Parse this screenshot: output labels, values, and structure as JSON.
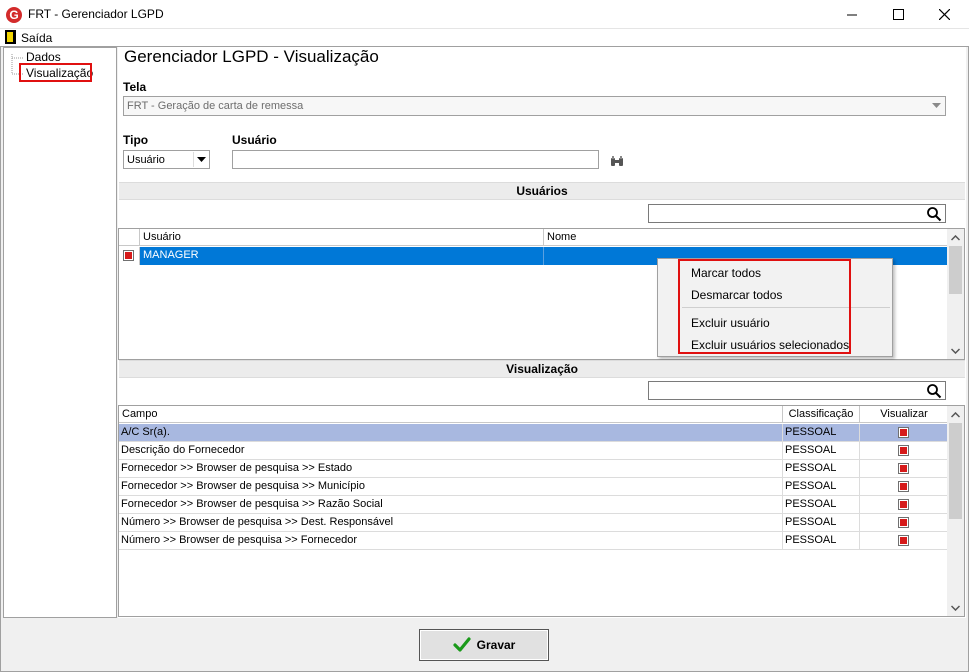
{
  "window": {
    "title": "FRT - Gerenciador LGPD",
    "app_icon_letter": "G"
  },
  "menu": {
    "exit_label": "Saída"
  },
  "tree": {
    "items": [
      "Dados",
      "Visualização"
    ]
  },
  "page": {
    "title": "Gerenciador LGPD - Visualização"
  },
  "form": {
    "tela_label": "Tela",
    "tela_value": "FRT - Geração de carta de remessa",
    "tipo_label": "Tipo",
    "tipo_value": "Usuário",
    "usuario_label": "Usuário",
    "usuario_value": ""
  },
  "users_section": {
    "title": "Usuários",
    "search_value": "",
    "columns": [
      "Usuário",
      "Nome"
    ],
    "rows": [
      {
        "checked": true,
        "usuario": "MANAGER",
        "nome": ""
      }
    ]
  },
  "context_menu": {
    "items": [
      "Marcar todos",
      "Desmarcar todos",
      "Excluir usuário",
      "Excluir usuários selecionados"
    ]
  },
  "view_section": {
    "title": "Visualização",
    "search_value": "",
    "columns": [
      "Campo",
      "Classificação",
      "Visualizar"
    ],
    "rows": [
      {
        "campo": "A/C Sr(a).",
        "classificacao": "PESSOAL",
        "visualizar": true
      },
      {
        "campo": "Descrição do Fornecedor",
        "classificacao": "PESSOAL",
        "visualizar": true
      },
      {
        "campo": "Fornecedor >> Browser de pesquisa >> Estado",
        "classificacao": "PESSOAL",
        "visualizar": true
      },
      {
        "campo": "Fornecedor >> Browser de pesquisa >> Município",
        "classificacao": "PESSOAL",
        "visualizar": true
      },
      {
        "campo": "Fornecedor >> Browser de pesquisa >> Razão Social",
        "classificacao": "PESSOAL",
        "visualizar": true
      },
      {
        "campo": "Número >> Browser de pesquisa >> Dest. Responsável",
        "classificacao": "PESSOAL",
        "visualizar": true
      },
      {
        "campo": "Número >> Browser de pesquisa >> Fornecedor",
        "classificacao": "PESSOAL",
        "visualizar": true
      }
    ]
  },
  "actions": {
    "save_label": "Gravar"
  },
  "colors": {
    "selection_blue": "#0078d7",
    "row_highlight": "#a8b8e0",
    "annotation_red": "#e01010",
    "check_red": "#d61a1a"
  }
}
